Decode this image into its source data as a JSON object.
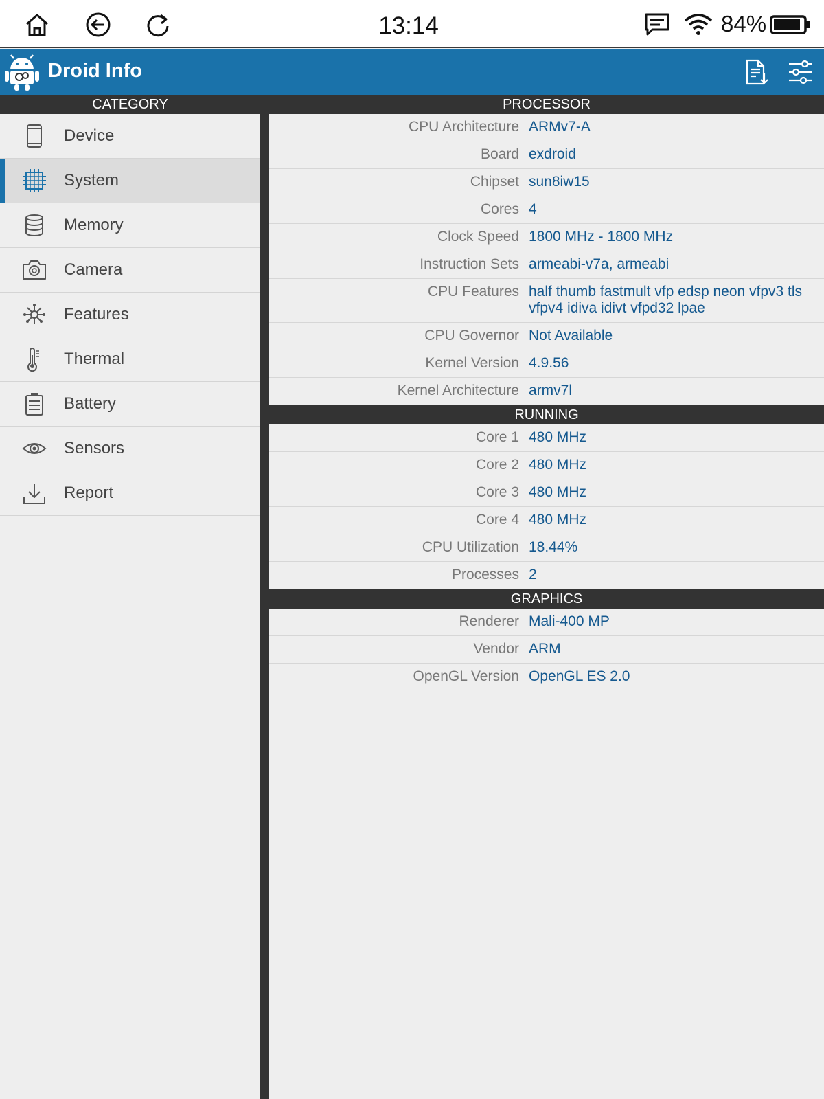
{
  "status_bar": {
    "time": "13:14",
    "battery_percent": "84%",
    "icons": [
      "home-icon",
      "back-icon",
      "refresh-icon",
      "message-icon",
      "wifi-icon",
      "battery-icon"
    ]
  },
  "toolbar": {
    "title": "Droid Info",
    "actions": [
      "report-export-icon",
      "settings-sliders-icon"
    ]
  },
  "colors": {
    "accent": "#1a72aa",
    "value_text": "#15598f",
    "header_bg": "#333333"
  },
  "sidebar": {
    "header": "CATEGORY",
    "items": [
      {
        "label": "Device",
        "icon": "phone-icon"
      },
      {
        "label": "System",
        "icon": "chip-icon",
        "selected": true
      },
      {
        "label": "Memory",
        "icon": "memory-icon"
      },
      {
        "label": "Camera",
        "icon": "camera-icon"
      },
      {
        "label": "Features",
        "icon": "features-icon"
      },
      {
        "label": "Thermal",
        "icon": "thermometer-icon"
      },
      {
        "label": "Battery",
        "icon": "battery-icon"
      },
      {
        "label": "Sensors",
        "icon": "eye-icon"
      },
      {
        "label": "Report",
        "icon": "download-icon"
      }
    ]
  },
  "sections": [
    {
      "title": "PROCESSOR",
      "rows": [
        {
          "key": "CPU Architecture",
          "value": "ARMv7-A"
        },
        {
          "key": "Board",
          "value": "exdroid"
        },
        {
          "key": "Chipset",
          "value": "sun8iw15"
        },
        {
          "key": "Cores",
          "value": "4"
        },
        {
          "key": "Clock Speed",
          "value": "1800 MHz - 1800 MHz"
        },
        {
          "key": "Instruction Sets",
          "value": "armeabi-v7a, armeabi"
        },
        {
          "key": "CPU Features",
          "value": "half thumb fastmult vfp edsp neon vfpv3 tls vfpv4 idiva idivt vfpd32 lpae"
        },
        {
          "key": "CPU Governor",
          "value": "Not Available"
        },
        {
          "key": "Kernel Version",
          "value": "4.9.56"
        },
        {
          "key": "Kernel Architecture",
          "value": "armv7l"
        }
      ]
    },
    {
      "title": "RUNNING",
      "rows": [
        {
          "key": "Core 1",
          "value": "480 MHz"
        },
        {
          "key": "Core 2",
          "value": "480 MHz"
        },
        {
          "key": "Core 3",
          "value": "480 MHz"
        },
        {
          "key": "Core 4",
          "value": "480 MHz"
        },
        {
          "key": "CPU Utilization",
          "value": "18.44%"
        },
        {
          "key": "Processes",
          "value": "2"
        }
      ]
    },
    {
      "title": "GRAPHICS",
      "rows": [
        {
          "key": "Renderer",
          "value": "Mali-400 MP"
        },
        {
          "key": "Vendor",
          "value": "ARM"
        },
        {
          "key": "OpenGL Version",
          "value": "OpenGL ES 2.0"
        }
      ]
    }
  ]
}
